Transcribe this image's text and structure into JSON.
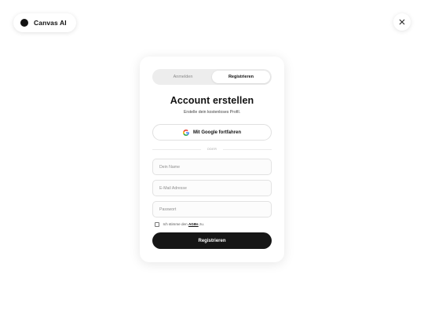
{
  "brand": {
    "name": "Canvas AI"
  },
  "tabs": [
    {
      "label": "Anmelden",
      "active": false
    },
    {
      "label": "Registrieren",
      "active": true
    }
  ],
  "card": {
    "title": "Account erstellen",
    "subtitle": "Erstelle dein kostenloses Profil."
  },
  "google": {
    "label": "Mit Google fortfahren",
    "icon": "google-icon"
  },
  "divider": {
    "label": "ODER"
  },
  "fields": {
    "name": {
      "placeholder": "Dein Name",
      "value": ""
    },
    "email": {
      "placeholder": "E-Mail Adresse",
      "value": ""
    },
    "password": {
      "placeholder": "Passwort",
      "value": ""
    }
  },
  "terms": {
    "prefix": "Ich stimme den",
    "link": "AGBs",
    "suffix": "zu.",
    "checked": false
  },
  "submit": {
    "label": "Registrieren"
  },
  "colors": {
    "primary": "#161616",
    "background": "#ffffff",
    "tab_track": "#ededed",
    "border": "#e2e2e2"
  }
}
